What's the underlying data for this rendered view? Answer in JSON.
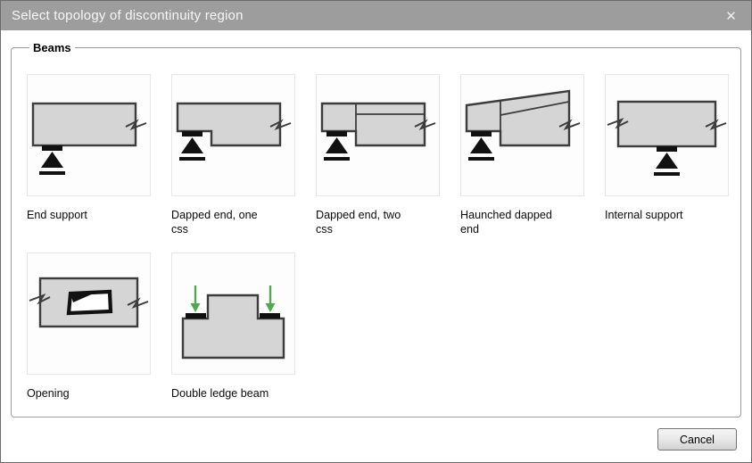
{
  "window": {
    "title": "Select topology of discontinuity region",
    "close_glyph": "✕"
  },
  "group": {
    "label": "Beams"
  },
  "items": [
    {
      "id": "end-support",
      "label": "End support"
    },
    {
      "id": "dapped-end-one-css",
      "label": "Dapped end, one css"
    },
    {
      "id": "dapped-end-two-css",
      "label": "Dapped end, two css"
    },
    {
      "id": "haunched-dapped-end",
      "label": "Haunched dapped end"
    },
    {
      "id": "internal-support",
      "label": "Internal support"
    },
    {
      "id": "opening",
      "label": "Opening"
    },
    {
      "id": "double-ledge-beam",
      "label": "Double ledge beam"
    }
  ],
  "footer": {
    "cancel_label": "Cancel"
  },
  "colors": {
    "titlebar_bg": "#9d9d9d",
    "titlebar_text": "#f7f7f7",
    "window_border": "#6b6b6b",
    "group_border": "#9b9b9b",
    "thumb_border": "#e6e6e6",
    "thumb_bg": "#fdfdfd",
    "beam_fill": "#d5d5d5",
    "beam_outline": "#3c3c3c",
    "support_black": "#111111",
    "arrow_green": "#53a653",
    "button_border": "#747474"
  }
}
